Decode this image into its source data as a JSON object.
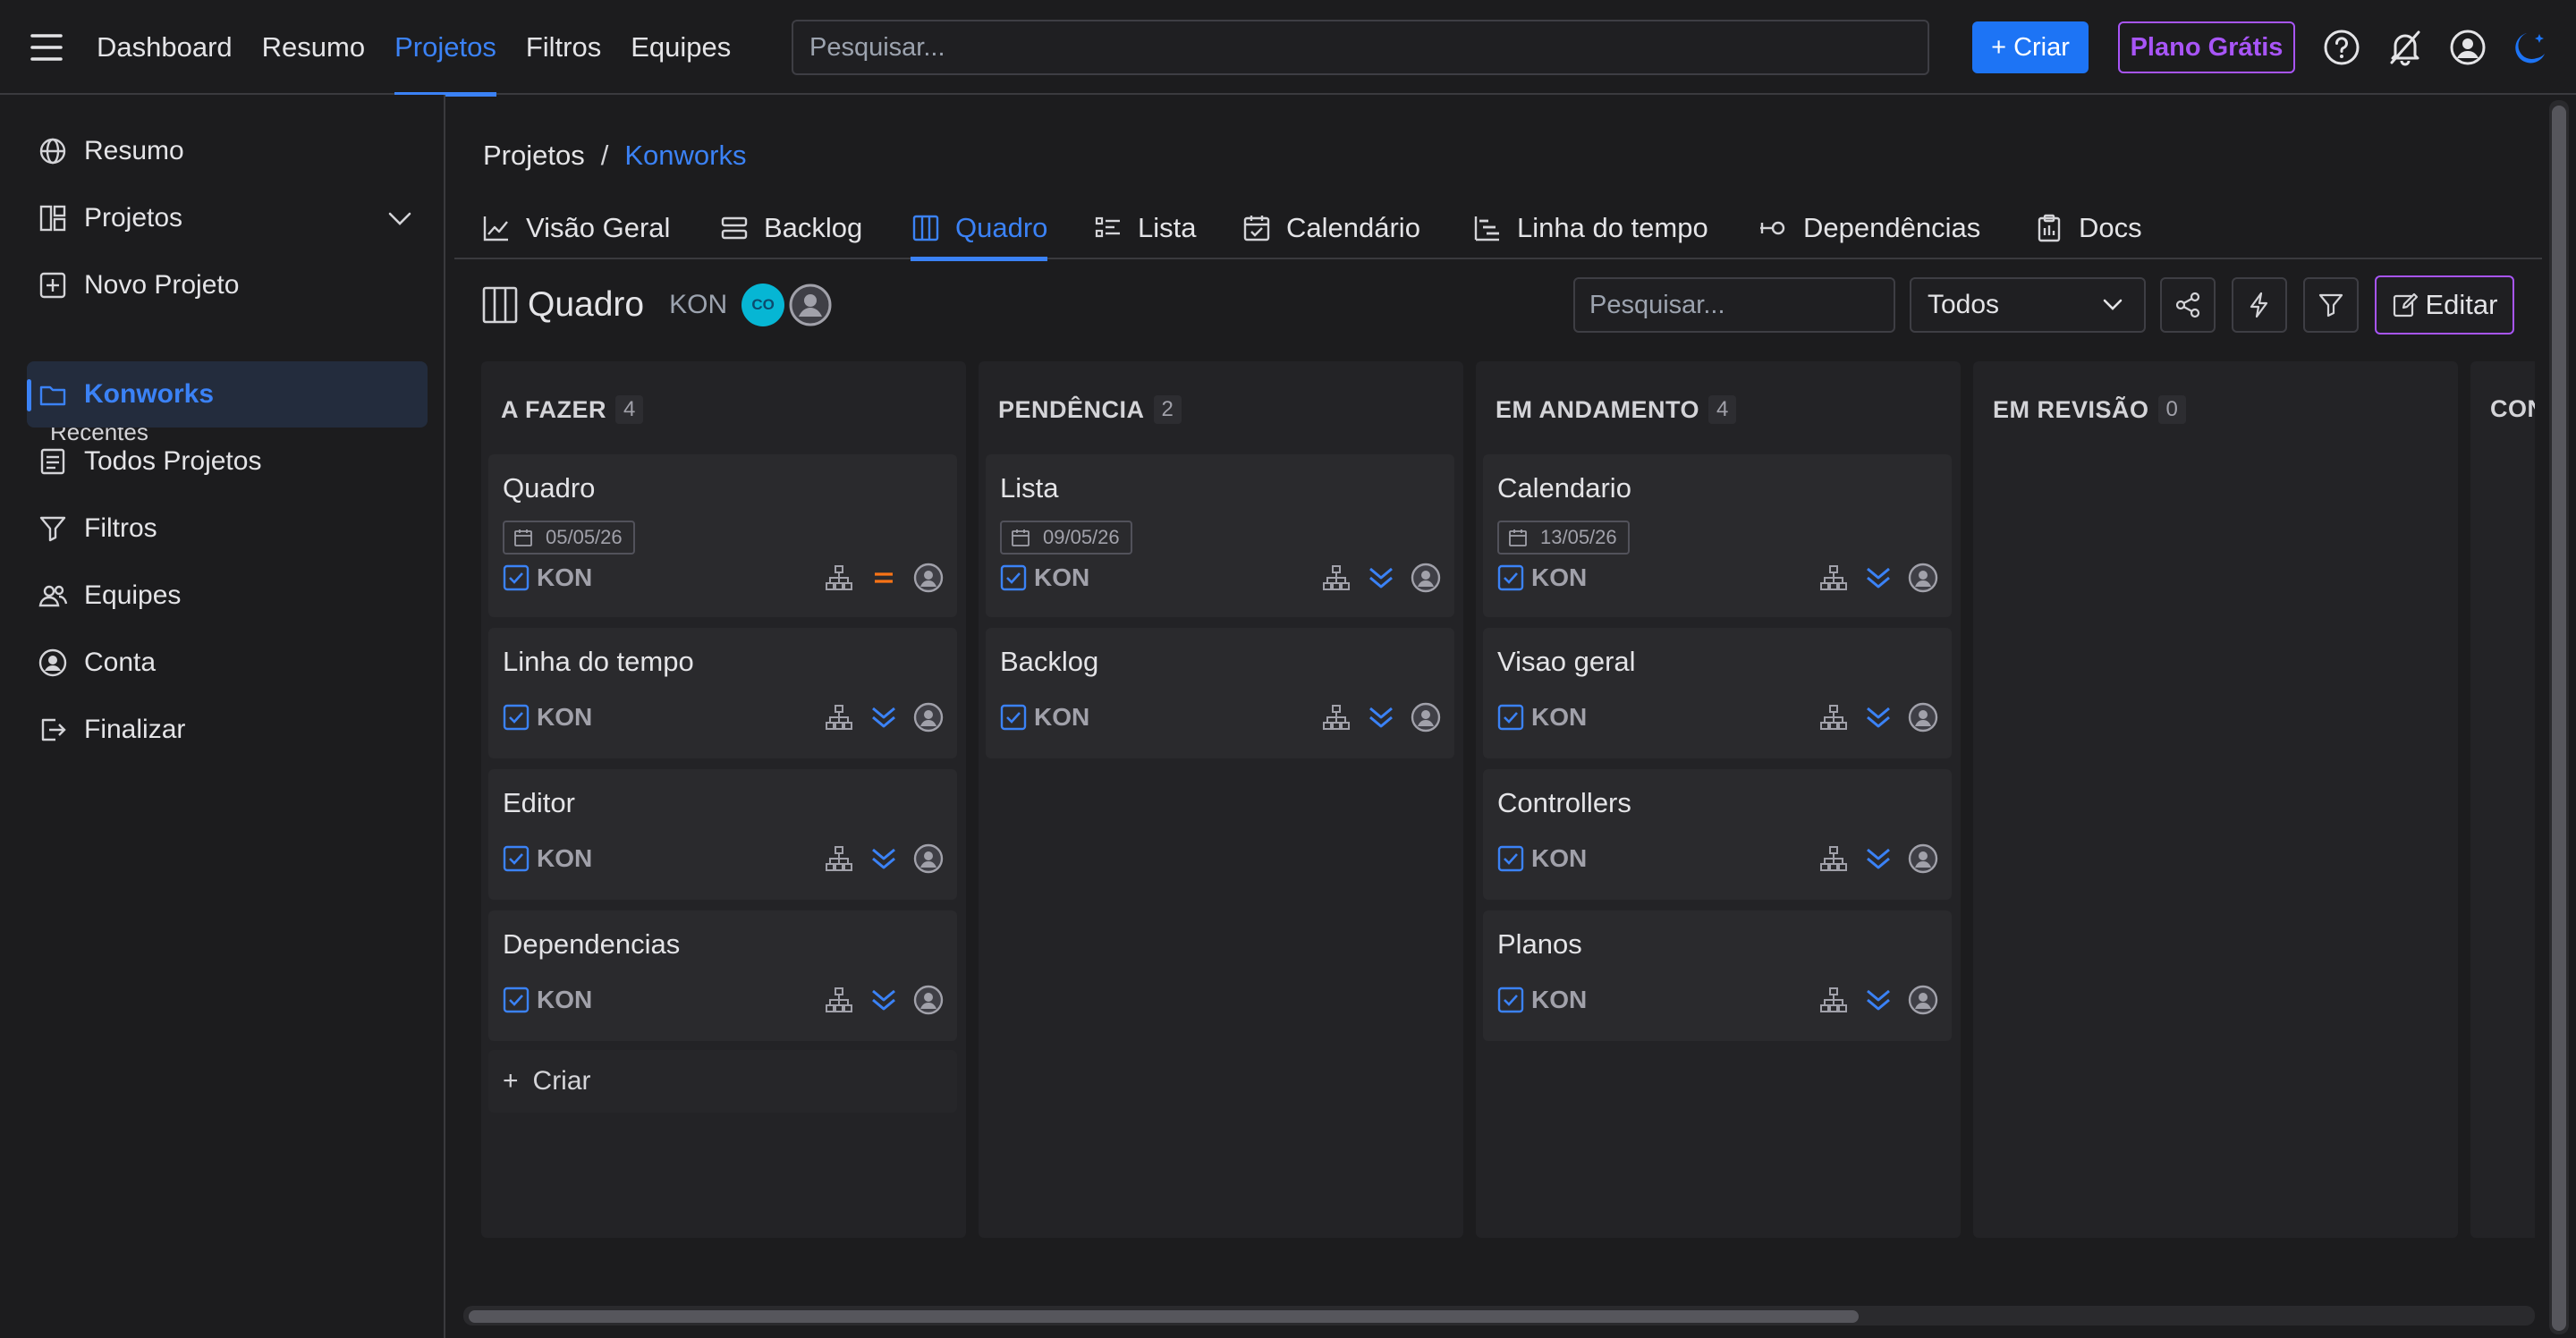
{
  "topnav": {
    "items": [
      {
        "label": "Dashboard",
        "active": false
      },
      {
        "label": "Resumo",
        "active": false
      },
      {
        "label": "Projetos",
        "active": true
      },
      {
        "label": "Filtros",
        "active": false
      },
      {
        "label": "Equipes",
        "active": false
      }
    ],
    "search_placeholder": "Pesquisar...",
    "create_label": "+ Criar",
    "plan_label": "Plano Grátis",
    "icons": [
      "help-icon",
      "notifications-off-icon",
      "account-icon",
      "theme-moon-icon"
    ]
  },
  "sidebar": {
    "items": [
      {
        "label": "Resumo",
        "icon": "globe-icon"
      },
      {
        "label": "Projetos",
        "icon": "layout-icon",
        "expandable": true
      },
      {
        "label": "Novo Projeto",
        "icon": "plus-square-icon"
      },
      {
        "label": "Konworks",
        "icon": "folder-icon",
        "active": true
      },
      {
        "label": "Todos Projetos",
        "icon": "list-box-icon"
      },
      {
        "label": "Filtros",
        "icon": "filter-icon"
      },
      {
        "label": "Equipes",
        "icon": "users-icon"
      },
      {
        "label": "Conta",
        "icon": "user-circle-icon"
      },
      {
        "label": "Finalizar",
        "icon": "logout-icon"
      }
    ],
    "recent_label": "Recentes"
  },
  "breadcrumb": {
    "root": "Projetos",
    "separator": "/",
    "current": "Konworks"
  },
  "tabs": [
    {
      "label": "Visão Geral",
      "icon": "chart-line-icon"
    },
    {
      "label": "Backlog",
      "icon": "stack-icon"
    },
    {
      "label": "Quadro",
      "icon": "columns-icon",
      "active": true
    },
    {
      "label": "Lista",
      "icon": "list-icon"
    },
    {
      "label": "Calendário",
      "icon": "calendar-icon"
    },
    {
      "label": "Linha do tempo",
      "icon": "timeline-icon"
    },
    {
      "label": "Dependências",
      "icon": "dependency-icon"
    },
    {
      "label": "Docs",
      "icon": "clipboard-icon"
    }
  ],
  "board": {
    "title": "Quadro",
    "key": "KON",
    "avatar_initials": "CO",
    "search_placeholder": "Pesquisar...",
    "filter_select": "Todos",
    "edit_label": "Editar",
    "create_label": "Criar"
  },
  "columns": [
    {
      "title": "A FAZER",
      "count": "4",
      "cards": [
        {
          "title": "Quadro",
          "date": "05/05/26",
          "key": "KON",
          "priority": "medium"
        },
        {
          "title": "Linha do tempo",
          "key": "KON",
          "priority": "low"
        },
        {
          "title": "Editor",
          "key": "KON",
          "priority": "low"
        },
        {
          "title": "Dependencias",
          "key": "KON",
          "priority": "low"
        }
      ]
    },
    {
      "title": "PENDÊNCIA",
      "count": "2",
      "cards": [
        {
          "title": "Lista",
          "date": "09/05/26",
          "key": "KON",
          "priority": "low"
        },
        {
          "title": "Backlog",
          "key": "KON",
          "priority": "low"
        }
      ]
    },
    {
      "title": "EM ANDAMENTO",
      "count": "4",
      "cards": [
        {
          "title": "Calendario",
          "date": "13/05/26",
          "key": "KON",
          "priority": "low"
        },
        {
          "title": "Visao geral",
          "key": "KON",
          "priority": "low"
        },
        {
          "title": "Controllers",
          "key": "KON",
          "priority": "low"
        },
        {
          "title": "Planos",
          "key": "KON",
          "priority": "low"
        }
      ]
    },
    {
      "title": "EM REVISÃO",
      "count": "0",
      "cards": []
    },
    {
      "title": "CON",
      "count": "",
      "cards": []
    }
  ],
  "colors": {
    "accent": "#3b82f6",
    "create_button": "#1d74f5",
    "plan_border": "#a855f7",
    "priority_medium": "#f97316",
    "priority_low": "#3b82f6",
    "avatar_co": "#06b6d4"
  }
}
